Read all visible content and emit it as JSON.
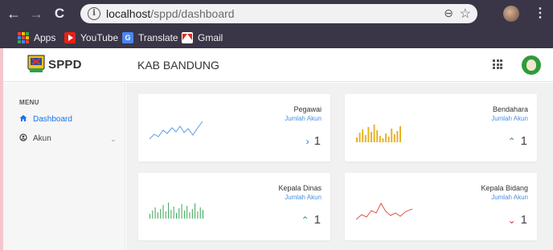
{
  "browser": {
    "url_host": "localhost",
    "url_path": "/sppd/dashboard",
    "nav": {
      "back": "←",
      "forward": "→",
      "reload": "C"
    },
    "bookmarks": [
      {
        "label": "Apps",
        "icon": "apps-icon"
      },
      {
        "label": "YouTube",
        "icon": "youtube-icon"
      },
      {
        "label": "Translate",
        "icon": "translate-icon"
      },
      {
        "label": "Gmail",
        "icon": "gmail-icon"
      }
    ]
  },
  "header": {
    "brand": "SPPD",
    "region": "KAB BANDUNG",
    "apps_icon": "grid-icon",
    "avatar_icon": "user-avatar"
  },
  "sidebar": {
    "menu_label": "MENU",
    "items": [
      {
        "label": "Dashboard",
        "icon": "home-icon",
        "active": true
      },
      {
        "label": "Akun",
        "icon": "account-icon",
        "active": false,
        "expandable": true
      }
    ]
  },
  "cards": [
    {
      "title": "Pegawai",
      "subtitle": "Jumlah Akun",
      "value": "1",
      "trend": "right",
      "trend_glyph": "›",
      "trend_color": "#1a73e8",
      "chart": "line",
      "chart_color": "#5b9be8"
    },
    {
      "title": "Bendahara",
      "subtitle": "Jumlah Akun",
      "value": "1",
      "trend": "up",
      "trend_glyph": "⌃",
      "trend_color": "#2e9e4a",
      "chart": "bar",
      "chart_color": "#e8b22a"
    },
    {
      "title": "Kepala Dinas",
      "subtitle": "Jumlah Akun",
      "value": "1",
      "trend": "up",
      "trend_glyph": "⌃",
      "trend_color": "#2e9e4a",
      "chart": "bar-thin",
      "chart_color": "#3aa655"
    },
    {
      "title": "Kepala Bidang",
      "subtitle": "Jumlah Akun",
      "value": "1",
      "trend": "down",
      "trend_glyph": "⌄",
      "trend_color": "#d9332b",
      "chart": "line",
      "chart_color": "#e0524a"
    }
  ]
}
